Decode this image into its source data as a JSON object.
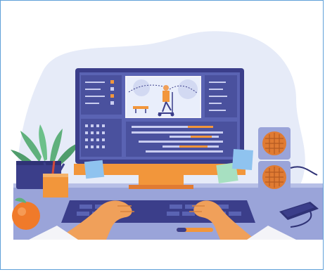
{
  "illustration": {
    "subject": "video-editor-workstation",
    "colors": {
      "blob": "#e6ebf8",
      "desk": "#9aa4d9",
      "monitor_frame": "#3b3e8a",
      "screen_panel": "#5a63b3",
      "screen_panel_dark": "#4a519e",
      "accent_orange": "#f2963b",
      "orange_light": "#f5b36a",
      "skin": "#f0a05a",
      "sleeve": "#f4f4f8",
      "keyboard": "#3b3e8a",
      "speaker": "#9aa4d9",
      "speaker_grill": "#e07b33",
      "plant_leaf": "#5fb07c",
      "pot": "#3b3e8a",
      "sticky_note_blue": "#8fc3ef",
      "sticky_note_green": "#a7e0c1",
      "phone": "#2f3276"
    },
    "icons": [
      "monitor-icon",
      "keyboard-icon",
      "speaker-icon",
      "plant-icon",
      "orange-fruit-icon",
      "pencil-cup-icon",
      "smartphone-icon",
      "pen-icon",
      "sticky-note-icon"
    ]
  }
}
